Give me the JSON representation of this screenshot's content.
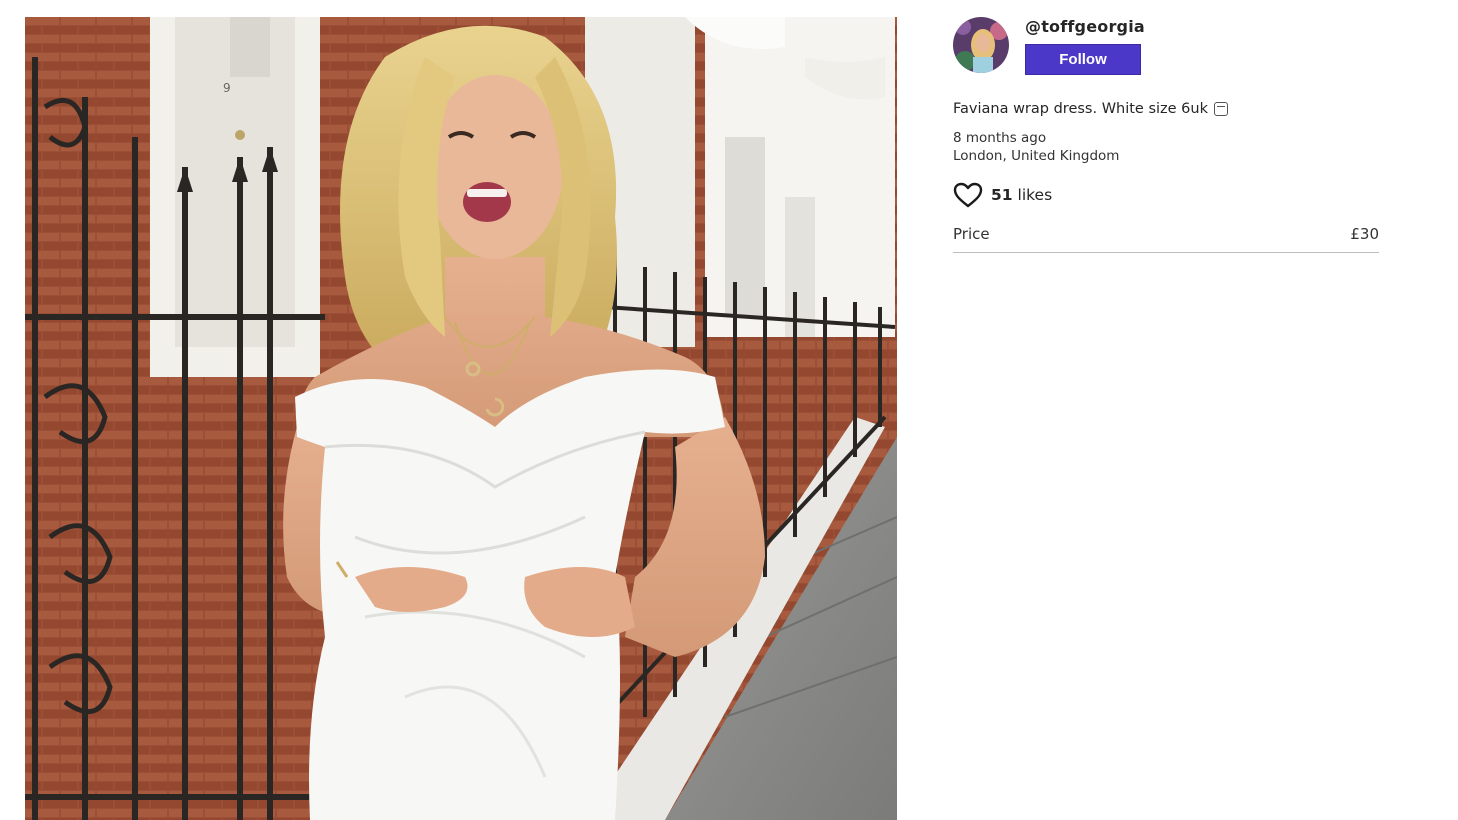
{
  "listing": {
    "image_alt": "Woman in white off-shoulder wrap dress standing by black iron railings in a London street",
    "seller": {
      "username": "@toffgeorgia",
      "follow_label": "Follow"
    },
    "description": "Faviana wrap dress. White size 6uk",
    "description_icon": "clock-emoji-icon",
    "posted": "8 months ago",
    "location": "London, United Kingdom",
    "likes": {
      "count": "51",
      "label": "likes"
    },
    "price": {
      "label": "Price",
      "value": "£30"
    }
  },
  "colors": {
    "follow_button": "#4b38c9",
    "divider": "#bdbdbd"
  }
}
